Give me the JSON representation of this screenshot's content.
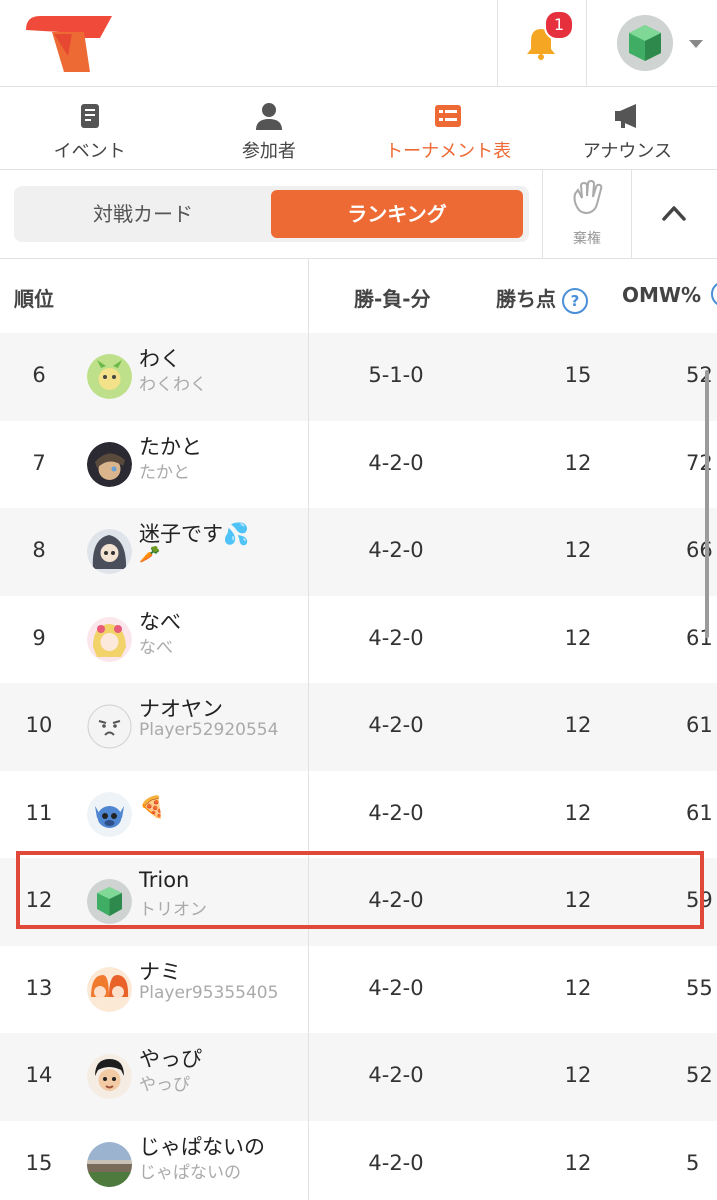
{
  "header": {
    "notification_count": "1",
    "brand_color": "#ee6a35"
  },
  "nav": {
    "tabs": [
      {
        "label": "イベント",
        "icon": "event-doc-icon"
      },
      {
        "label": "参加者",
        "icon": "person-icon"
      },
      {
        "label": "トーナメント表",
        "icon": "bracket-list-icon",
        "active": true
      },
      {
        "label": "アナウンス",
        "icon": "megaphone-icon"
      }
    ]
  },
  "segment": {
    "left_label": "対戦カード",
    "right_label": "ランキング",
    "forfeit_label": "棄権"
  },
  "table": {
    "headers": {
      "rank": "順位",
      "record": "勝-負-分",
      "points": "勝ち点",
      "help": "?",
      "omw": "OMW%"
    },
    "rows": [
      {
        "rank": "6",
        "name": "わく",
        "sub": "わくわく",
        "record": "5-1-0",
        "points": "15",
        "omw": "52"
      },
      {
        "rank": "7",
        "name": "たかと",
        "sub": "たかと",
        "record": "4-2-0",
        "points": "12",
        "omw": "72"
      },
      {
        "rank": "8",
        "name": "迷子です💦",
        "sub": "🥕",
        "record": "4-2-0",
        "points": "12",
        "omw": "66"
      },
      {
        "rank": "9",
        "name": "なべ",
        "sub": "なべ",
        "record": "4-2-0",
        "points": "12",
        "omw": "61"
      },
      {
        "rank": "10",
        "name": "ナオヤン",
        "sub": "Player52920554",
        "record": "4-2-0",
        "points": "12",
        "omw": "61"
      },
      {
        "rank": "11",
        "name": "🍕",
        "sub": "",
        "record": "4-2-0",
        "points": "12",
        "omw": "61"
      },
      {
        "rank": "12",
        "name": "Trion",
        "sub": "トリオン",
        "record": "4-2-0",
        "points": "12",
        "omw": "59"
      },
      {
        "rank": "13",
        "name": "ナミ",
        "sub": "Player95355405",
        "record": "4-2-0",
        "points": "12",
        "omw": "55"
      },
      {
        "rank": "14",
        "name": "やっぴ",
        "sub": "やっぴ",
        "record": "4-2-0",
        "points": "12",
        "omw": "52"
      },
      {
        "rank": "15",
        "name": "じゃぱないの",
        "sub": "じゃぱないの",
        "record": "4-2-0",
        "points": "12",
        "omw": "5"
      }
    ]
  }
}
